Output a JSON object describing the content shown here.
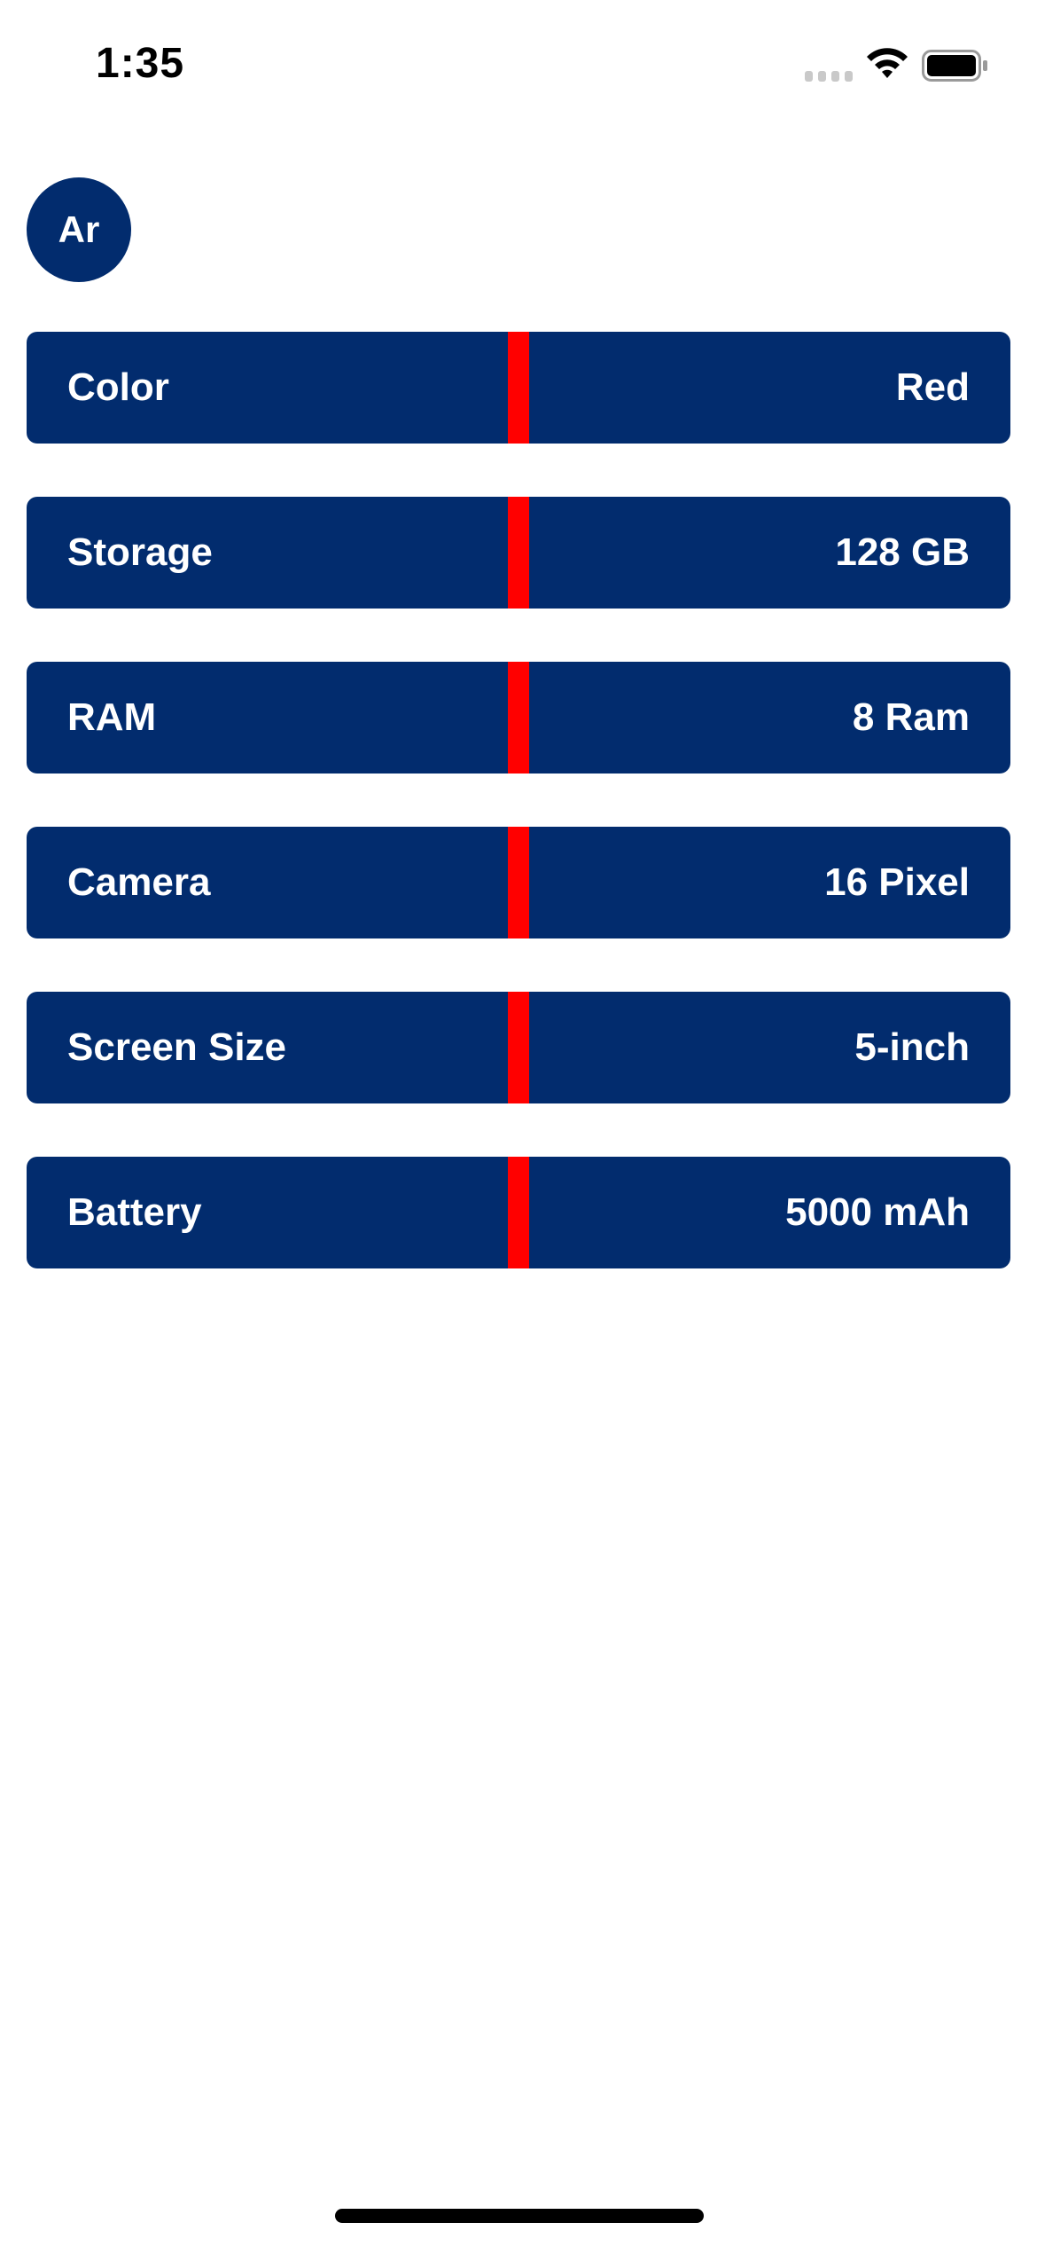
{
  "status_bar": {
    "time": "1:35"
  },
  "avatar": {
    "initials": "Ar"
  },
  "specs": [
    {
      "label": "Color",
      "value": "Red"
    },
    {
      "label": "Storage",
      "value": "128 GB"
    },
    {
      "label": "RAM",
      "value": "8 Ram"
    },
    {
      "label": "Camera",
      "value": "16 Pixel"
    },
    {
      "label": "Screen Size",
      "value": "5-inch"
    },
    {
      "label": "Battery",
      "value": "5000 mAh"
    }
  ],
  "colors": {
    "row_background": "#022C6E",
    "divider": "#FF0000",
    "text": "#FFFFFF"
  },
  "icons": {
    "signal": "cellular-signal-icon",
    "wifi": "wifi-icon",
    "battery": "battery-icon"
  }
}
